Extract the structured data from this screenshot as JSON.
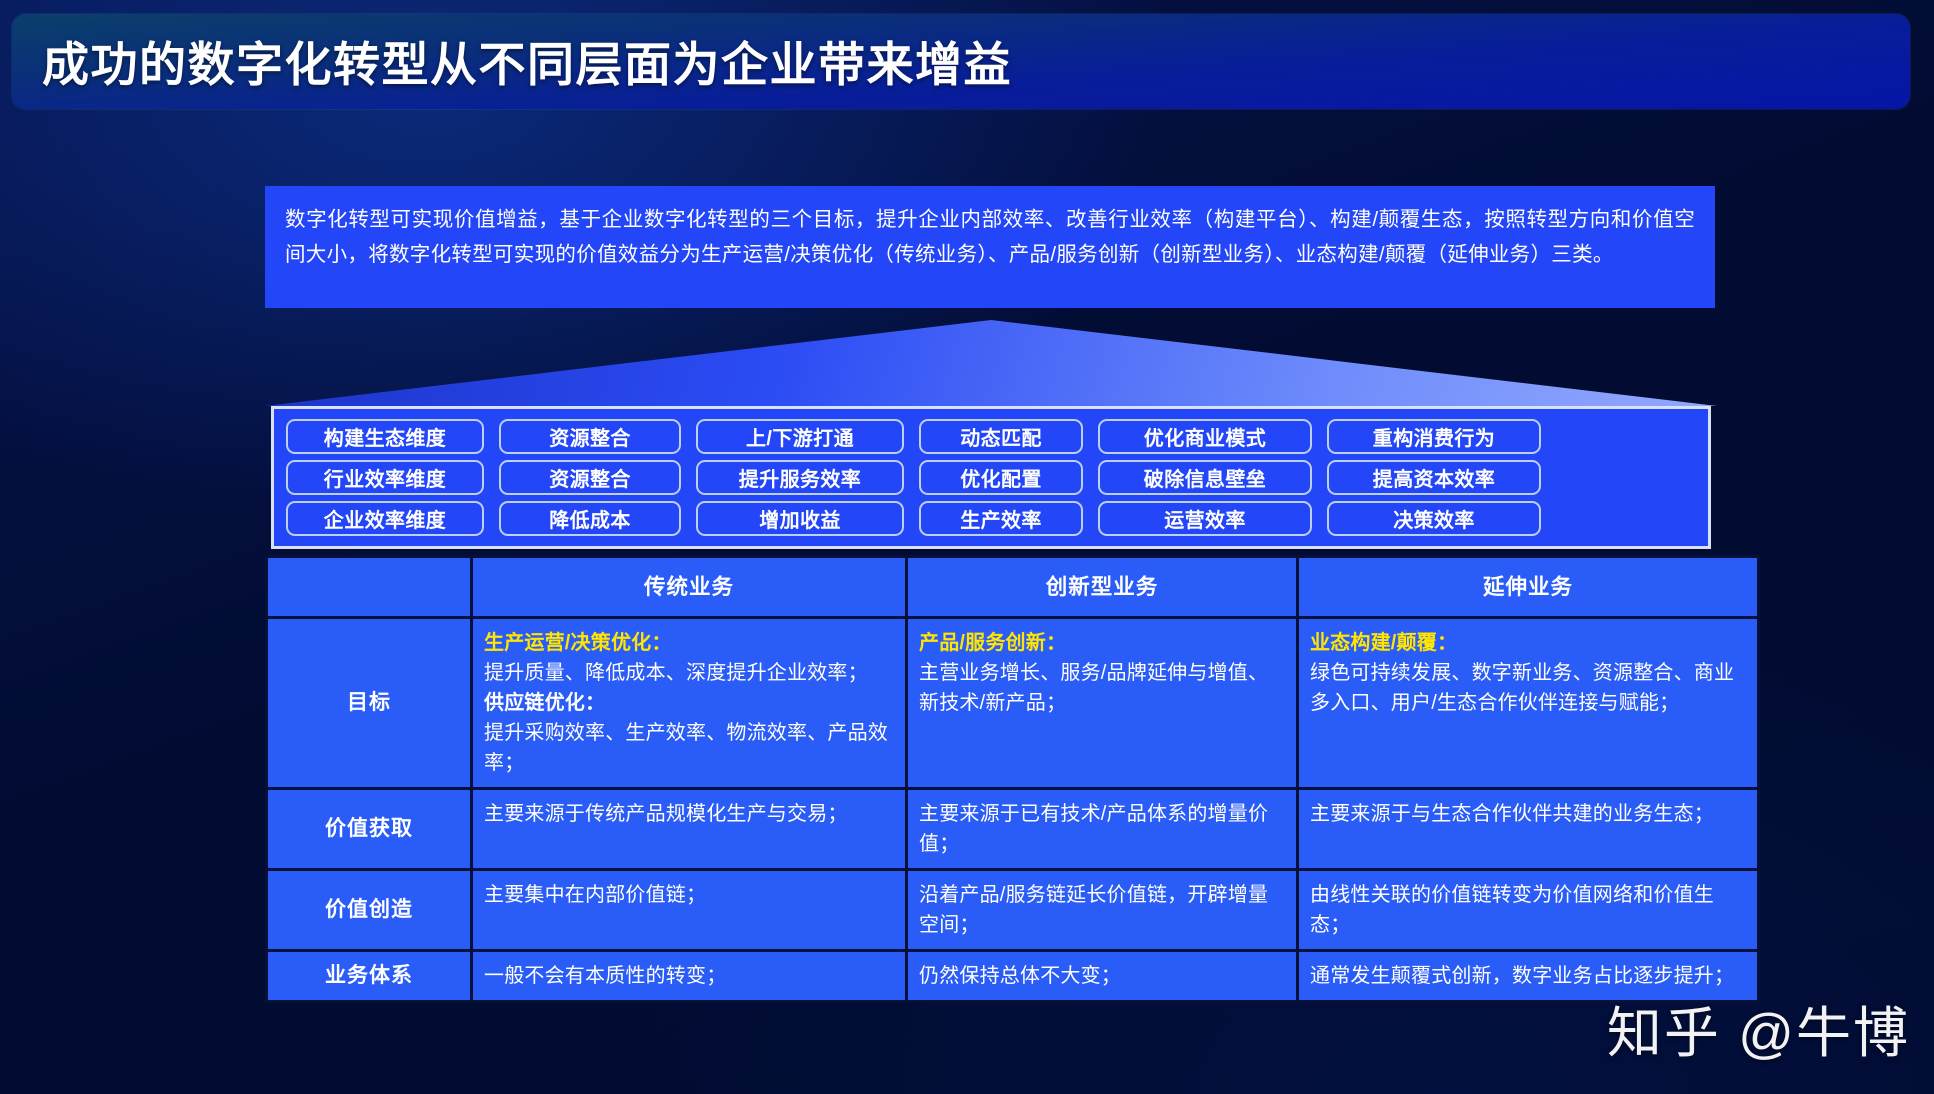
{
  "slide": {
    "title": "成功的数字化转型从不同层面为企业带来增益",
    "intro": "数字化转型可实现价值增益，基于企业数字化转型的三个目标，提升企业内部效率、改善行业效率（构建平台）、构建/颠覆生态，按照转型方向和价值空间大小，将数字化转型可实现的价值效益分为生产运营/决策优化（传统业务）、产品/服务创新（创新型业务）、业态构建/颠覆（延伸业务）三类。",
    "watermark": "知乎 @牛博"
  },
  "colors": {
    "background": "#010a2e",
    "title_gradient_start": "#0b3f6b",
    "title_gradient_end": "#0615a6",
    "intro_box": "#2346f8",
    "panel_blue": "#2346f8",
    "table_cell": "#2a5cf7",
    "grid_line": "#071038",
    "pill_border": "#bcd0f2",
    "accent_yellow": "#ffe600",
    "text_white": "#ffffff"
  },
  "pill_grid": {
    "rows": [
      {
        "dimension": "构建生态维度",
        "items": [
          "资源整合",
          "上/下游打通",
          "动态匹配",
          "优化商业模式",
          "重构消费行为"
        ]
      },
      {
        "dimension": "行业效率维度",
        "items": [
          "资源整合",
          "提升服务效率",
          "优化配置",
          "破除信息壁垒",
          "提高资本效率"
        ]
      },
      {
        "dimension": "企业效率维度",
        "items": [
          "降低成本",
          "增加收益",
          "生产效率",
          "运营效率",
          "决策效率"
        ]
      }
    ]
  },
  "matrix": {
    "headers": [
      "",
      "传统业务",
      "创新型业务",
      "延伸业务"
    ],
    "rows": [
      {
        "label": "目标",
        "traditional": {
          "lede_yellow": "生产运营/决策优化：",
          "body1": "提升质量、降低成本、深度提升企业效率；",
          "lede_white": "供应链优化：",
          "body2": "提升采购效率、生产效率、物流效率、产品效率；"
        },
        "innovative": {
          "lede_yellow": "产品/服务创新：",
          "body1": "主营业务增长、服务/品牌延伸与增值、新技术/新产品；"
        },
        "extended": {
          "lede_yellow": "业态构建/颠覆：",
          "body1": "绿色可持续发展、数字新业务、资源整合、商业多入口、用户/生态合作伙伴连接与赋能；"
        }
      },
      {
        "label": "价值获取",
        "traditional": "主要来源于传统产品规模化生产与交易；",
        "innovative": "主要来源于已有技术/产品体系的增量价值；",
        "extended": "主要来源于与生态合作伙伴共建的业务生态；"
      },
      {
        "label": "价值创造",
        "traditional": "主要集中在内部价值链；",
        "innovative": "沿着产品/服务链延长价值链，开辟增量空间；",
        "extended": "由线性关联的价值链转变为价值网络和价值生态；"
      },
      {
        "label": "业务体系",
        "traditional": "一般不会有本质性的转变；",
        "innovative": "仍然保持总体不大变；",
        "extended": "通常发生颠覆式创新，数字业务占比逐步提升；"
      }
    ]
  }
}
